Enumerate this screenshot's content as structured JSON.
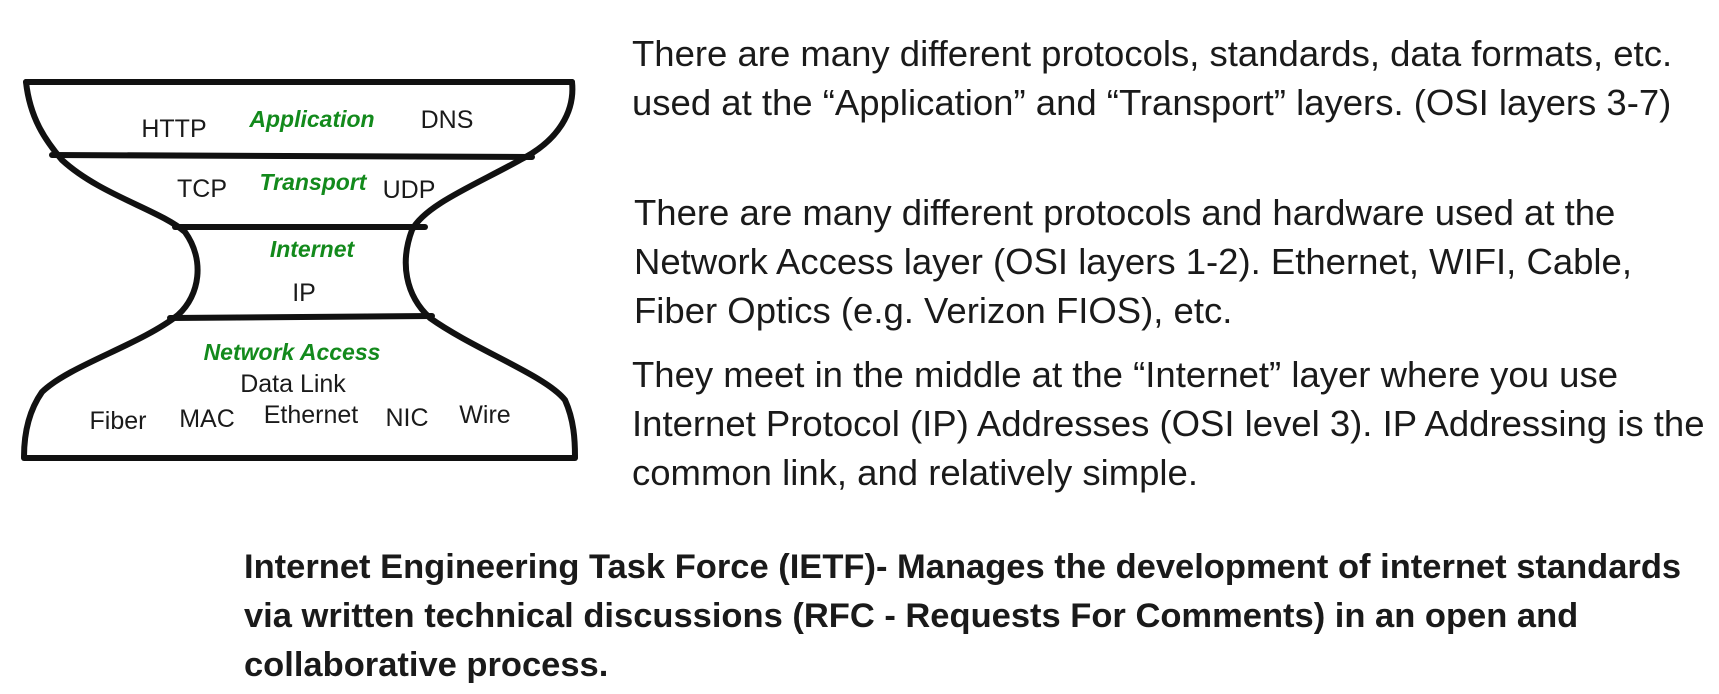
{
  "diagram": {
    "layers": [
      {
        "name": "Application",
        "protocols": [
          "HTTP",
          "DNS"
        ]
      },
      {
        "name": "Transport",
        "protocols": [
          "TCP",
          "UDP"
        ]
      },
      {
        "name": "Internet",
        "protocols": [
          "IP"
        ]
      },
      {
        "name": "Network Access",
        "sublabel": "Data Link",
        "protocols": [
          "Fiber",
          "MAC",
          "Ethernet",
          "NIC",
          "Wire"
        ]
      }
    ],
    "colors": {
      "outline": "#111111",
      "layer_label": "#138a1c",
      "text": "#1a1a1a"
    }
  },
  "paragraphs": [
    "There are many different protocols, standards, data formats, etc. used at the “Application” and “Transport” layers. (OSI layers 3-7)",
    "There are many different protocols and hardware used at the Network Access layer (OSI layers 1-2). Ethernet, WIFI, Cable, Fiber Optics (e.g. Verizon FIOS), etc.",
    "They meet in the middle at the “Internet” layer where you use Internet Protocol (IP) Addresses (OSI level 3). IP Addressing is the common link, and relatively simple."
  ],
  "ietf_note": "Internet Engineering Task Force (IETF)-  Manages the development of internet standards via written technical discussions (RFC - Requests For Comments) in an open and collaborative process."
}
